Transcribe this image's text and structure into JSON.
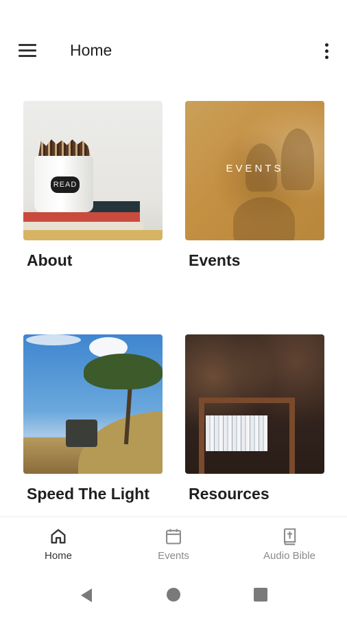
{
  "header": {
    "title": "Home",
    "menu_icon": "hamburger-menu-icon",
    "more_icon": "more-vertical-icon"
  },
  "tiles": [
    {
      "label": "About",
      "image": "jar-of-pencils-on-books-photo"
    },
    {
      "label": "Events",
      "image": "people-group-photo",
      "overlay_text": "EVENTS"
    },
    {
      "label": "Speed The Light",
      "image": "safari-tree-truck-photo"
    },
    {
      "label": "Resources",
      "image": "wooden-bookshelf-photo"
    }
  ],
  "bottom_nav": {
    "items": [
      {
        "label": "Home",
        "icon": "home-icon",
        "active": true
      },
      {
        "label": "Events",
        "icon": "calendar-icon",
        "active": false
      },
      {
        "label": "Audio Bible",
        "icon": "bible-icon",
        "active": false
      }
    ]
  },
  "system_nav": {
    "back_icon": "back-triangle-icon",
    "home_icon": "home-circle-icon",
    "recents_icon": "recents-square-icon"
  },
  "colors": {
    "active_nav": "#333333",
    "inactive_nav": "#8a8a8a",
    "background": "#ffffff"
  }
}
